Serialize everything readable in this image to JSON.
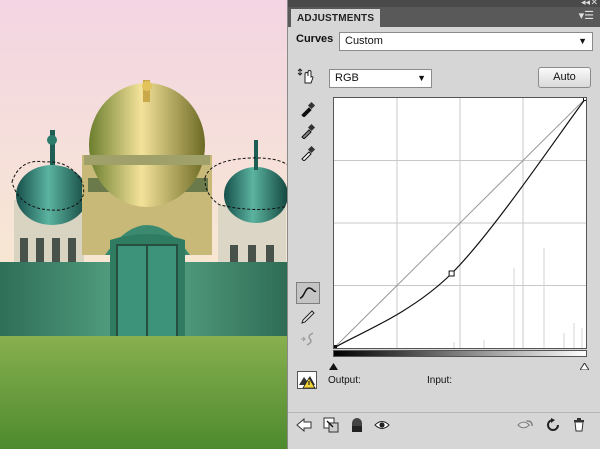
{
  "panel": {
    "tab_label": "ADJUSTMENTS",
    "adjustment_name": "Curves",
    "preset": {
      "value": "Custom"
    },
    "channel": {
      "value": "RGB"
    },
    "auto_label": "Auto",
    "output_label": "Output:",
    "input_label": "Input:"
  },
  "curve": {
    "input_range": [
      0,
      255
    ],
    "control_points": [
      [
        0,
        0
      ],
      [
        119,
        76
      ],
      [
        255,
        255
      ]
    ]
  },
  "icons": {
    "on_image": "hand-adjust-icon",
    "eyedroppers": [
      "eyedropper-black-icon",
      "eyedropper-gray-icon",
      "eyedropper-white-icon"
    ],
    "bottom": [
      "back-arrow-icon",
      "clip-layer-icon",
      "mask-icon",
      "eye-icon",
      "view-previous-icon",
      "reset-icon",
      "trash-icon"
    ]
  },
  "colors": {
    "panel_bg": "#d6d6d6",
    "tab_bar": "#595959",
    "sky_top": "#f1d6e2",
    "dome_teal": "#2f8a7a",
    "wall_green": "#3f8f72",
    "grass": "#5f9a3c"
  }
}
